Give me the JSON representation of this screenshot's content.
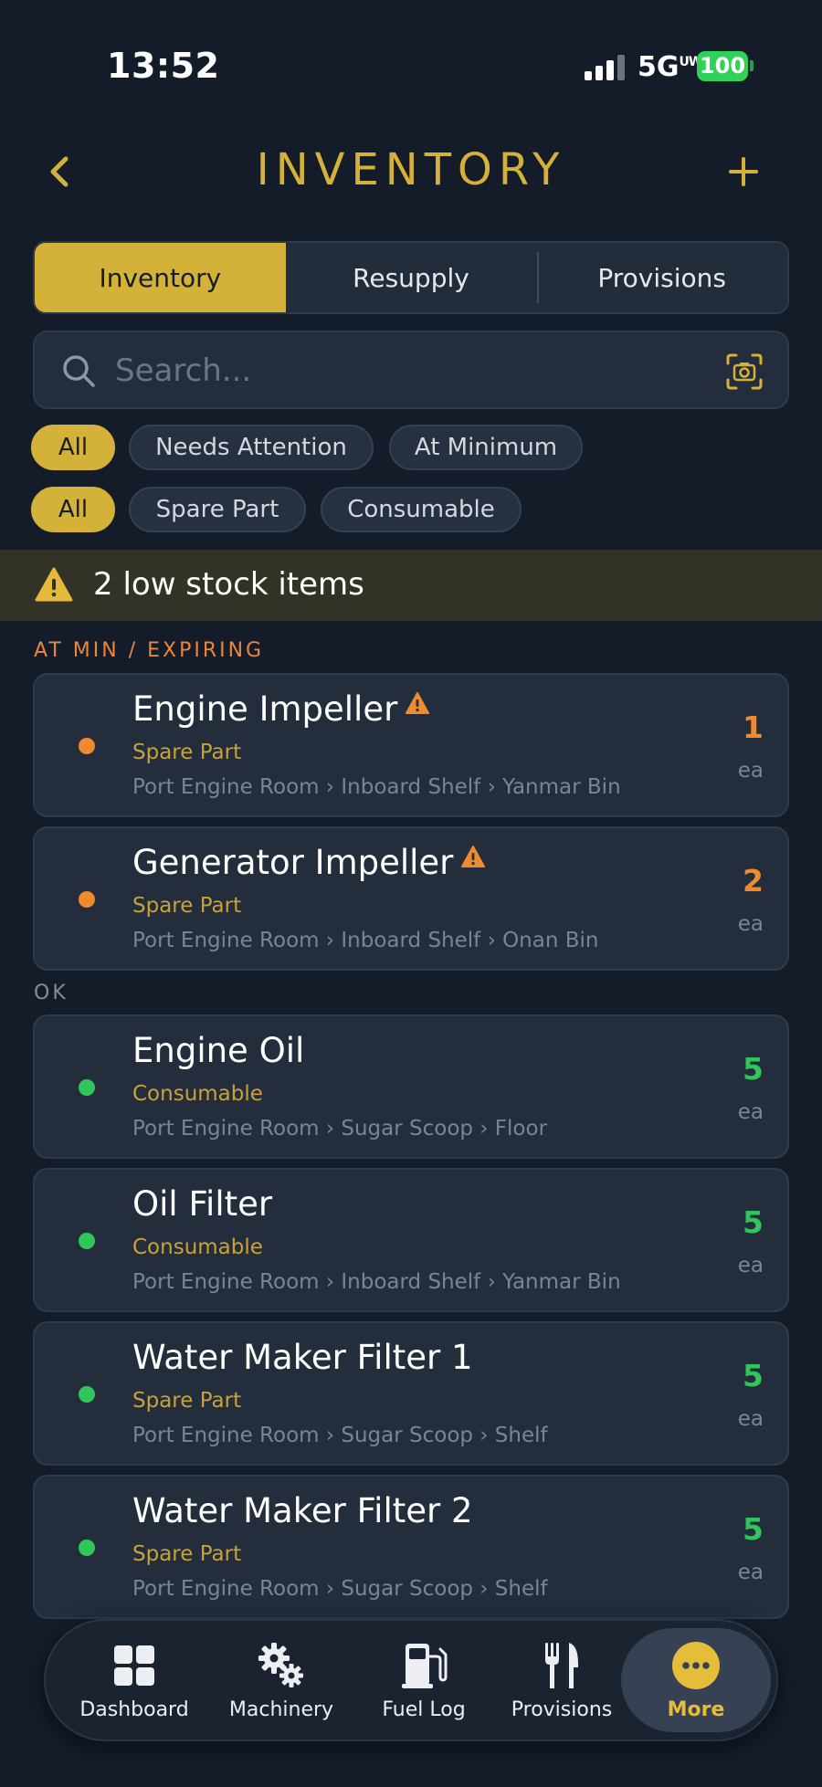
{
  "status_bar": {
    "time": "13:52",
    "network": "5G",
    "network_suffix": "UW",
    "battery": "100"
  },
  "header": {
    "title": "INVENTORY",
    "back_icon": "chevron-left-icon",
    "add_icon": "plus-icon"
  },
  "segments": [
    "Inventory",
    "Resupply",
    "Provisions"
  ],
  "search": {
    "placeholder": "Search..."
  },
  "filters_status": [
    "All",
    "Needs Attention",
    "At Minimum"
  ],
  "filters_type": [
    "All",
    "Spare Part",
    "Consumable"
  ],
  "banner": {
    "text": "2 low stock items"
  },
  "sections": {
    "warning_label": "AT MIN / EXPIRING",
    "ok_label": "OK"
  },
  "items_warning": [
    {
      "name": "Engine Impeller",
      "category": "Spare Part",
      "location": "Port Engine Room › Inboard Shelf › Yanmar Bin",
      "qty": "1",
      "unit": "ea"
    },
    {
      "name": "Generator Impeller",
      "category": "Spare Part",
      "location": "Port Engine Room › Inboard Shelf › Onan Bin",
      "qty": "2",
      "unit": "ea"
    }
  ],
  "items_ok": [
    {
      "name": "Engine Oil",
      "category": "Consumable",
      "location": "Port Engine Room › Sugar Scoop › Floor",
      "qty": "5",
      "unit": "ea"
    },
    {
      "name": "Oil Filter",
      "category": "Consumable",
      "location": "Port Engine Room › Inboard Shelf › Yanmar Bin",
      "qty": "5",
      "unit": "ea"
    },
    {
      "name": "Water Maker Filter 1",
      "category": "Spare Part",
      "location": "Port Engine Room › Sugar Scoop › Shelf",
      "qty": "5",
      "unit": "ea"
    },
    {
      "name": "Water Maker Filter 2",
      "category": "Spare Part",
      "location": "Port Engine Room › Sugar Scoop › Shelf",
      "qty": "5",
      "unit": "ea"
    }
  ],
  "tabs": [
    {
      "label": "Dashboard",
      "icon": "grid-icon"
    },
    {
      "label": "Machinery",
      "icon": "gears-icon"
    },
    {
      "label": "Fuel Log",
      "icon": "fuel-pump-icon"
    },
    {
      "label": "Provisions",
      "icon": "fork-knife-icon"
    },
    {
      "label": "More",
      "icon": "more-icon"
    }
  ],
  "colors": {
    "accent": "#d4b23a",
    "warning": "#f08a2e",
    "ok": "#31c65a",
    "background": "#151c29",
    "card": "#232d3c"
  }
}
